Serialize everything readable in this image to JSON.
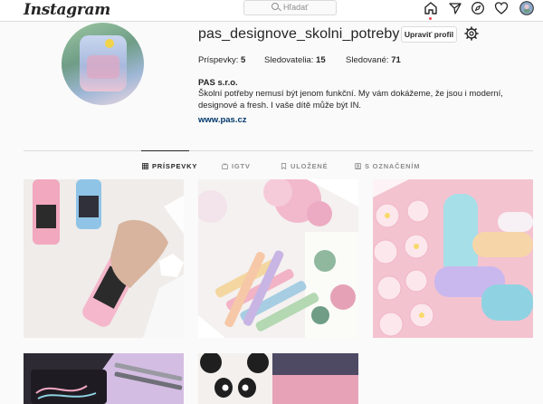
{
  "topnav": {
    "logo": "Instagram",
    "search_placeholder": "Hľadať",
    "icons": [
      "home-icon",
      "direct-icon",
      "explore-icon",
      "activity-icon",
      "profile-avatar-icon"
    ]
  },
  "profile": {
    "username": "pas_designove_skolni_potreby",
    "edit_button": "Upraviť profil",
    "stats": {
      "posts_label": "Príspevky:",
      "posts_value": "5",
      "followers_label": "Sledovatelia:",
      "followers_value": "15",
      "following_label": "Sledované:",
      "following_value": "71"
    },
    "full_name": "PAS s.r.o.",
    "bio": "Školní potřeby nemusí být jenom funkční. My vám dokážeme, že jsou i moderní, designové a fresh. I vaše dítě může být IN.",
    "website": "www.pas.cz"
  },
  "tabs": [
    {
      "label": "PRÍSPEVKY",
      "icon": "grid-icon",
      "active": true
    },
    {
      "label": "IGTV",
      "icon": "igtv-icon",
      "active": false
    },
    {
      "label": "ULOŽENÉ",
      "icon": "bookmark-icon",
      "active": false
    },
    {
      "label": "S OZNAČENÍM",
      "icon": "tagged-icon",
      "active": false
    }
  ],
  "colors": {
    "accent_link": "#00376b",
    "notification_dot": "#ed4956",
    "border": "#dbdbdb",
    "text": "#262626",
    "muted": "#8e8e8e"
  }
}
